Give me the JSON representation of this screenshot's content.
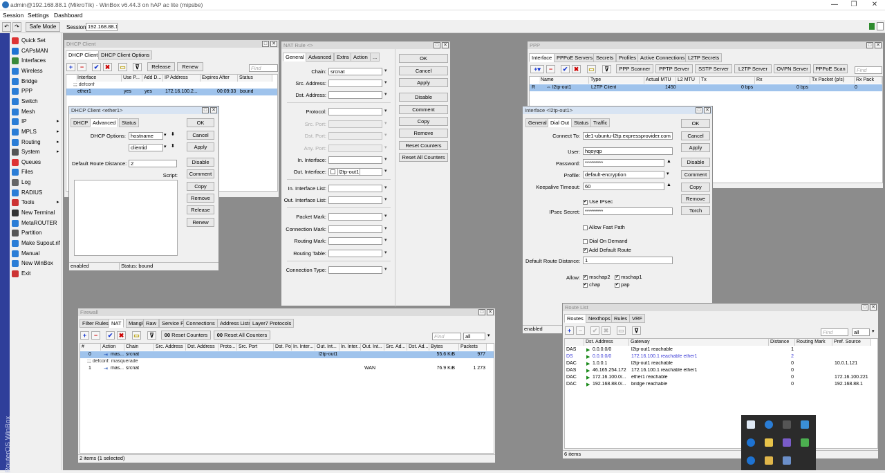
{
  "app": {
    "title": "admin@192.168.88.1 (MikroTik) - WinBox v6.44.3 on hAP ac lite (mipsbe)"
  },
  "menu": [
    "Session",
    "Settings",
    "Dashboard"
  ],
  "toolbar": {
    "safe_mode": "Safe Mode",
    "session_label": "Session:",
    "session_value": "192.168.88.1"
  },
  "brand": "RouterOS WinBox",
  "sidebar": [
    "Quick Set",
    "CAPsMAN",
    "Interfaces",
    "Wireless",
    "Bridge",
    "PPP",
    "Switch",
    "Mesh",
    "IP",
    "MPLS",
    "Routing",
    "System",
    "Queues",
    "Files",
    "Log",
    "RADIUS",
    "Tools",
    "New Terminal",
    "MetaROUTER",
    "Partition",
    "Make Supout.rif",
    "Manual",
    "New WinBox",
    "Exit"
  ],
  "dhcp_client": {
    "title": "DHCP Client",
    "tabs": [
      "DHCP Client",
      "DHCP Client Options"
    ],
    "btns": [
      "Release",
      "Renew"
    ],
    "find": "Find",
    "cols": [
      "Interface",
      "Use P...",
      "Add D...",
      "IP Address",
      "Expires After",
      "Status"
    ],
    "comment": ";;; defconf",
    "row": [
      "ether1",
      "yes",
      "yes",
      "172.16.100.2...",
      "00:09:33",
      "bound"
    ]
  },
  "dhcp_edit": {
    "title": "DHCP Client <ether1>",
    "tabs": [
      "DHCP",
      "Advanced",
      "Status"
    ],
    "options_label": "DHCP Options:",
    "opt1": "hostname",
    "opt2": "clientid",
    "dist_label": "Default Route Distance:",
    "dist": "2",
    "script_label": "Script:",
    "buttons": [
      "OK",
      "Cancel",
      "Apply",
      "Disable",
      "Comment",
      "Copy",
      "Remove",
      "Release",
      "Renew"
    ],
    "status_left": "enabled",
    "status_right": "Status: bound"
  },
  "nat_rule": {
    "title": "NAT Rule <>",
    "tabs": [
      "General",
      "Advanced",
      "Extra",
      "Action",
      "..."
    ],
    "fields": [
      {
        "label": "Chain:",
        "value": "srcnat",
        "enabled": true
      },
      {
        "label": "Src. Address:",
        "value": "",
        "enabled": true
      },
      {
        "label": "Dst. Address:",
        "value": "",
        "enabled": true
      },
      {
        "label": "Protocol:",
        "value": "",
        "enabled": true
      },
      {
        "label": "Src. Port:",
        "value": "",
        "enabled": false
      },
      {
        "label": "Dst. Port:",
        "value": "",
        "enabled": false
      },
      {
        "label": "Any. Port:",
        "value": "",
        "enabled": false
      },
      {
        "label": "In. Interface:",
        "value": "",
        "enabled": true
      },
      {
        "label": "Out. Interface:",
        "value": "l2tp-out1",
        "enabled": true
      },
      {
        "label": "In. Interface List:",
        "value": "",
        "enabled": true
      },
      {
        "label": "Out. Interface List:",
        "value": "",
        "enabled": true
      },
      {
        "label": "Packet Mark:",
        "value": "",
        "enabled": true
      },
      {
        "label": "Connection Mark:",
        "value": "",
        "enabled": true
      },
      {
        "label": "Routing Mark:",
        "value": "",
        "enabled": true
      },
      {
        "label": "Routing Table:",
        "value": "",
        "enabled": true
      },
      {
        "label": "Connection Type:",
        "value": "",
        "enabled": true
      }
    ],
    "buttons": [
      "OK",
      "Cancel",
      "Apply",
      "Disable",
      "Comment",
      "Copy",
      "Remove",
      "Reset Counters",
      "Reset All Counters"
    ]
  },
  "ppp": {
    "title": "PPP",
    "tabs": [
      "Interface",
      "PPPoE Servers",
      "Secrets",
      "Profiles",
      "Active Connections",
      "L2TP Secrets"
    ],
    "btns": [
      "PPP Scanner",
      "PPTP Server",
      "SSTP Server",
      "L2TP Server",
      "OVPN Server",
      "PPPoE Scan"
    ],
    "find": "Find",
    "cols": [
      "Name",
      "Type",
      "Actual MTU",
      "L2 MTU",
      "Tx",
      "Rx",
      "Tx Packet (p/s)",
      "Rx Pack"
    ],
    "row": [
      "R",
      "l2tp-out1",
      "L2TP Client",
      "1450",
      "",
      "0 bps",
      "0 bps",
      "0"
    ]
  },
  "iface": {
    "title": "Interface <l2tp-out1>",
    "tabs": [
      "General",
      "Dial Out",
      "Status",
      "Traffic"
    ],
    "connect_label": "Connect To:",
    "connect": "de1-ubuntu-l2tp.expressprovider.com",
    "user_label": "User:",
    "user": "hqoyqp",
    "pass_label": "Password:",
    "pass": "*********",
    "profile_label": "Profile:",
    "profile": "default-encryption",
    "keepalive_label": "Keepalive Timeout:",
    "keepalive": "60",
    "use_ipsec": "Use IPsec",
    "secret_label": "IPsec Secret:",
    "secret": "*********",
    "allow_fast": "Allow Fast Path",
    "dial_demand": "Dial On Demand",
    "add_route": "Add Default Route",
    "dist_label": "Default Route Distance:",
    "dist": "1",
    "allow_label": "Allow:",
    "allow": [
      "mschap2",
      "mschap1",
      "chap",
      "pap"
    ],
    "buttons": [
      "OK",
      "Cancel",
      "Apply",
      "Disable",
      "Comment",
      "Copy",
      "Remove",
      "Torch"
    ],
    "status": "enabled"
  },
  "firewall": {
    "title": "Firewall",
    "tabs": [
      "Filter Rules",
      "NAT",
      "Mangle",
      "Raw",
      "Service Ports",
      "Connections",
      "Address Lists",
      "Layer7 Protocols"
    ],
    "btns": [
      "Reset Counters",
      "Reset All Counters"
    ],
    "find": "Find",
    "filter": "all",
    "cols": [
      "#",
      "Action",
      "Chain",
      "Src. Address",
      "Dst. Address",
      "Proto...",
      "Src. Port",
      "Dst. Port",
      "In. Inter...",
      "Out. Int...",
      "In. Inter...",
      "Out. Int...",
      "Src. Ad...",
      "Dst. Ad...",
      "Bytes",
      "Packets"
    ],
    "rows": [
      {
        "num": "0",
        "action": "mas...",
        "chain": "srcnat",
        "out": "l2tp-out1",
        "outlist": "",
        "bytes": "55.6 KiB",
        "packets": "977"
      },
      {
        "num": "1",
        "action": "mas...",
        "chain": "srcnat",
        "out": "",
        "outlist": "WAN",
        "bytes": "76.9 KiB",
        "packets": "1 273"
      }
    ],
    "comment": ";;; defconf: masquerade",
    "status": "2 items (1 selected)"
  },
  "routes": {
    "title": "Route List",
    "tabs": [
      "Routes",
      "Nexthops",
      "Rules",
      "VRF"
    ],
    "find": "Find",
    "filter": "all",
    "cols": [
      "Dst. Address",
      "Gateway",
      "Distance",
      "Routing Mark",
      "Pref. Source"
    ],
    "rows": [
      {
        "flag": "DAS",
        "dst": "0.0.0.0/0",
        "gw": "l2tp-out1 reachable",
        "dist": "1",
        "mark": "",
        "src": "",
        "blue": false
      },
      {
        "flag": "DS",
        "dst": "0.0.0.0/0",
        "gw": "172.16.100.1 reachable ether1",
        "dist": "2",
        "mark": "",
        "src": "",
        "blue": true
      },
      {
        "flag": "DAC",
        "dst": "1.0.0.1",
        "gw": "l2tp-out1 reachable",
        "dist": "0",
        "mark": "",
        "src": "10.0.1.121",
        "blue": false
      },
      {
        "flag": "DAS",
        "dst": "46.165.254.172",
        "gw": "172.16.100.1 reachable ether1",
        "dist": "0",
        "mark": "",
        "src": "",
        "blue": false
      },
      {
        "flag": "DAC",
        "dst": "172.16.100.0/...",
        "gw": "ether1 reachable",
        "dist": "0",
        "mark": "",
        "src": "172.16.100.221",
        "blue": false
      },
      {
        "flag": "DAC",
        "dst": "192.168.88.0/...",
        "gw": "bridge reachable",
        "dist": "0",
        "mark": "",
        "src": "192.168.88.1",
        "blue": false
      }
    ],
    "status": "6 items"
  }
}
